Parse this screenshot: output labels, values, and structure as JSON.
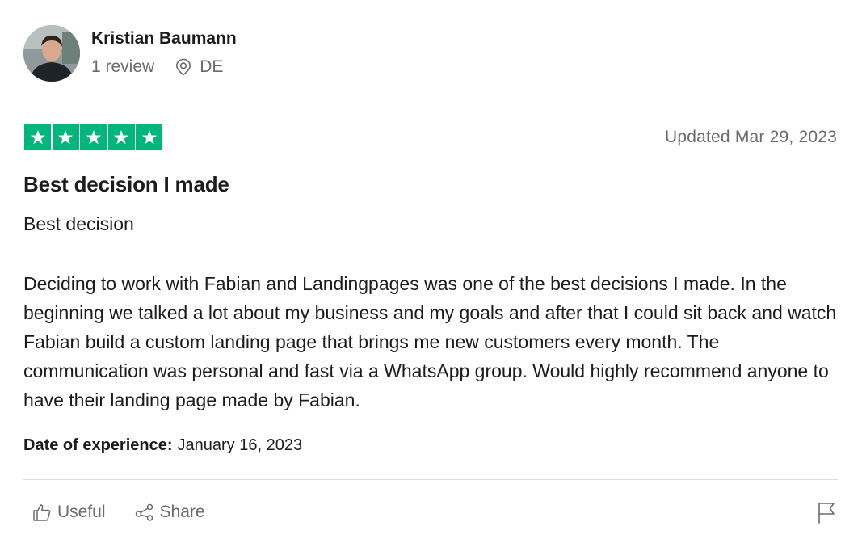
{
  "reviewer": {
    "name": "Kristian Baumann",
    "review_count": "1 review",
    "country": "DE"
  },
  "rating": {
    "stars": 5,
    "max_stars": 5,
    "color": "#00b67a"
  },
  "review": {
    "updated": "Updated Mar 29, 2023",
    "title": "Best decision I made",
    "subtitle": "Best decision",
    "body": "Deciding to work with Fabian and Landingpages was one of the best decisions I made. In the beginning we talked a lot about my business and my goals and after that I could sit back and watch Fabian build a custom landing page that brings me new customers every month. The communication was personal and fast via a WhatsApp group. Would highly recommend anyone to have their landing page made by Fabian.",
    "experience_label": "Date of experience:",
    "experience_date": "January 16, 2023"
  },
  "actions": {
    "useful_label": "Useful",
    "share_label": "Share"
  },
  "icons": {
    "location": "location-pin-icon",
    "useful": "thumbs-up-icon",
    "share": "share-icon",
    "report": "flag-icon",
    "star": "star-icon"
  }
}
